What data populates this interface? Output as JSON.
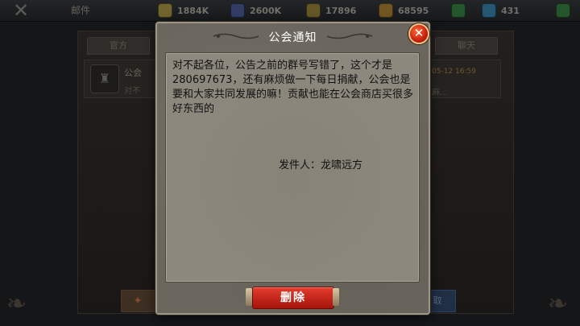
{
  "topbar": {
    "back_icon": "x-icon",
    "title": "邮件",
    "resources": [
      {
        "icon": "gold-icon",
        "color": "#d6b23a",
        "value": "1884K"
      },
      {
        "icon": "knight-icon",
        "color": "#5a6fc0",
        "value": "2600K"
      },
      {
        "icon": "coin-icon",
        "color": "#c9a23a",
        "value": "17896"
      },
      {
        "icon": "crate-icon",
        "color": "#c7a040",
        "value": "68595"
      },
      {
        "icon": "scroll-icon",
        "color": "#3aa84a",
        "value": ""
      },
      {
        "icon": "diamond-icon",
        "color": "#4fa8d8",
        "value": "431"
      },
      {
        "icon": "plus-icon",
        "color": "#3aa84a",
        "value": ""
      }
    ]
  },
  "mail": {
    "tabs": [
      "官方",
      "",
      "",
      "",
      "聊天"
    ],
    "row": {
      "subject": "公会",
      "preview": "对不",
      "date": "05-12 16:59",
      "more": "麻..."
    },
    "left_button": "",
    "right_button": "取"
  },
  "modal": {
    "title": "公会通知",
    "close_icon": "close-icon",
    "body": "对不起各位，公告之前的群号写错了，这个才是280697673，还有麻烦做一下每日捐献，公会也是要和大家共同发展的嘛！贡献也能在公会商店买很多好东西的",
    "sender": "发件人：龙啸远方",
    "delete_label": "删除"
  }
}
